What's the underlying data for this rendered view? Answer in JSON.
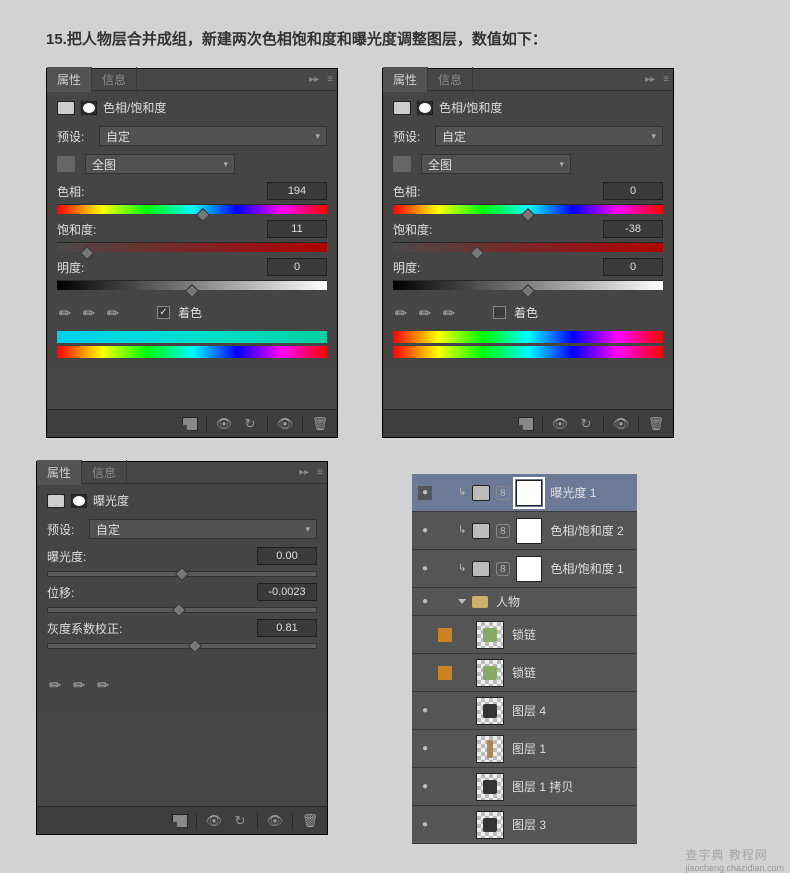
{
  "page": {
    "title": "15.把人物层合并成组，新建两次色相饱和度和曝光度调整图层，数值如下："
  },
  "common": {
    "tab_properties": "属性",
    "tab_info": "信息",
    "preset_label": "预设:",
    "preset_custom": "自定",
    "channel_all": "全图",
    "colorize_label": "着色"
  },
  "hsl": {
    "panel_name": "色相/饱和度",
    "hue_label": "色相:",
    "sat_label": "饱和度:",
    "light_label": "明度:"
  },
  "hsl1": {
    "hue": "194",
    "sat": "11",
    "light": "0",
    "colorize_checked": true
  },
  "hsl2": {
    "hue": "0",
    "sat": "-38",
    "light": "0",
    "colorize_checked": false
  },
  "expo": {
    "panel_name": "曝光度",
    "exposure_label": "曝光度:",
    "offset_label": "位移:",
    "gamma_label": "灰度系数校正:",
    "exposure": "0.00",
    "offset": "-0.0023",
    "gamma": "0.81"
  },
  "layers": [
    {
      "kind": "adj",
      "name": "曝光度 1",
      "selected": true,
      "eye": true
    },
    {
      "kind": "adj",
      "name": "色相/饱和度 2",
      "eye": true
    },
    {
      "kind": "adj",
      "name": "色相/饱和度 1",
      "eye": true
    },
    {
      "kind": "group",
      "name": "人物",
      "eye": true
    },
    {
      "kind": "img",
      "name": "锁链",
      "fx": true,
      "eye": false,
      "thumb": "a"
    },
    {
      "kind": "img",
      "name": "锁链",
      "fx": true,
      "eye": false,
      "thumb": "a"
    },
    {
      "kind": "img",
      "name": "图层 4",
      "eye": true,
      "thumb": "b"
    },
    {
      "kind": "img",
      "name": "图层 1",
      "eye": true,
      "thumb": "c"
    },
    {
      "kind": "img",
      "name": "图层 1 拷贝",
      "eye": true,
      "thumb": "b2"
    },
    {
      "kind": "img",
      "name": "图层 3",
      "eye": true,
      "thumb": "b2"
    }
  ],
  "watermark": {
    "brand": "查字典 教程网",
    "sub": "jiaocheng.chazidian.com"
  }
}
